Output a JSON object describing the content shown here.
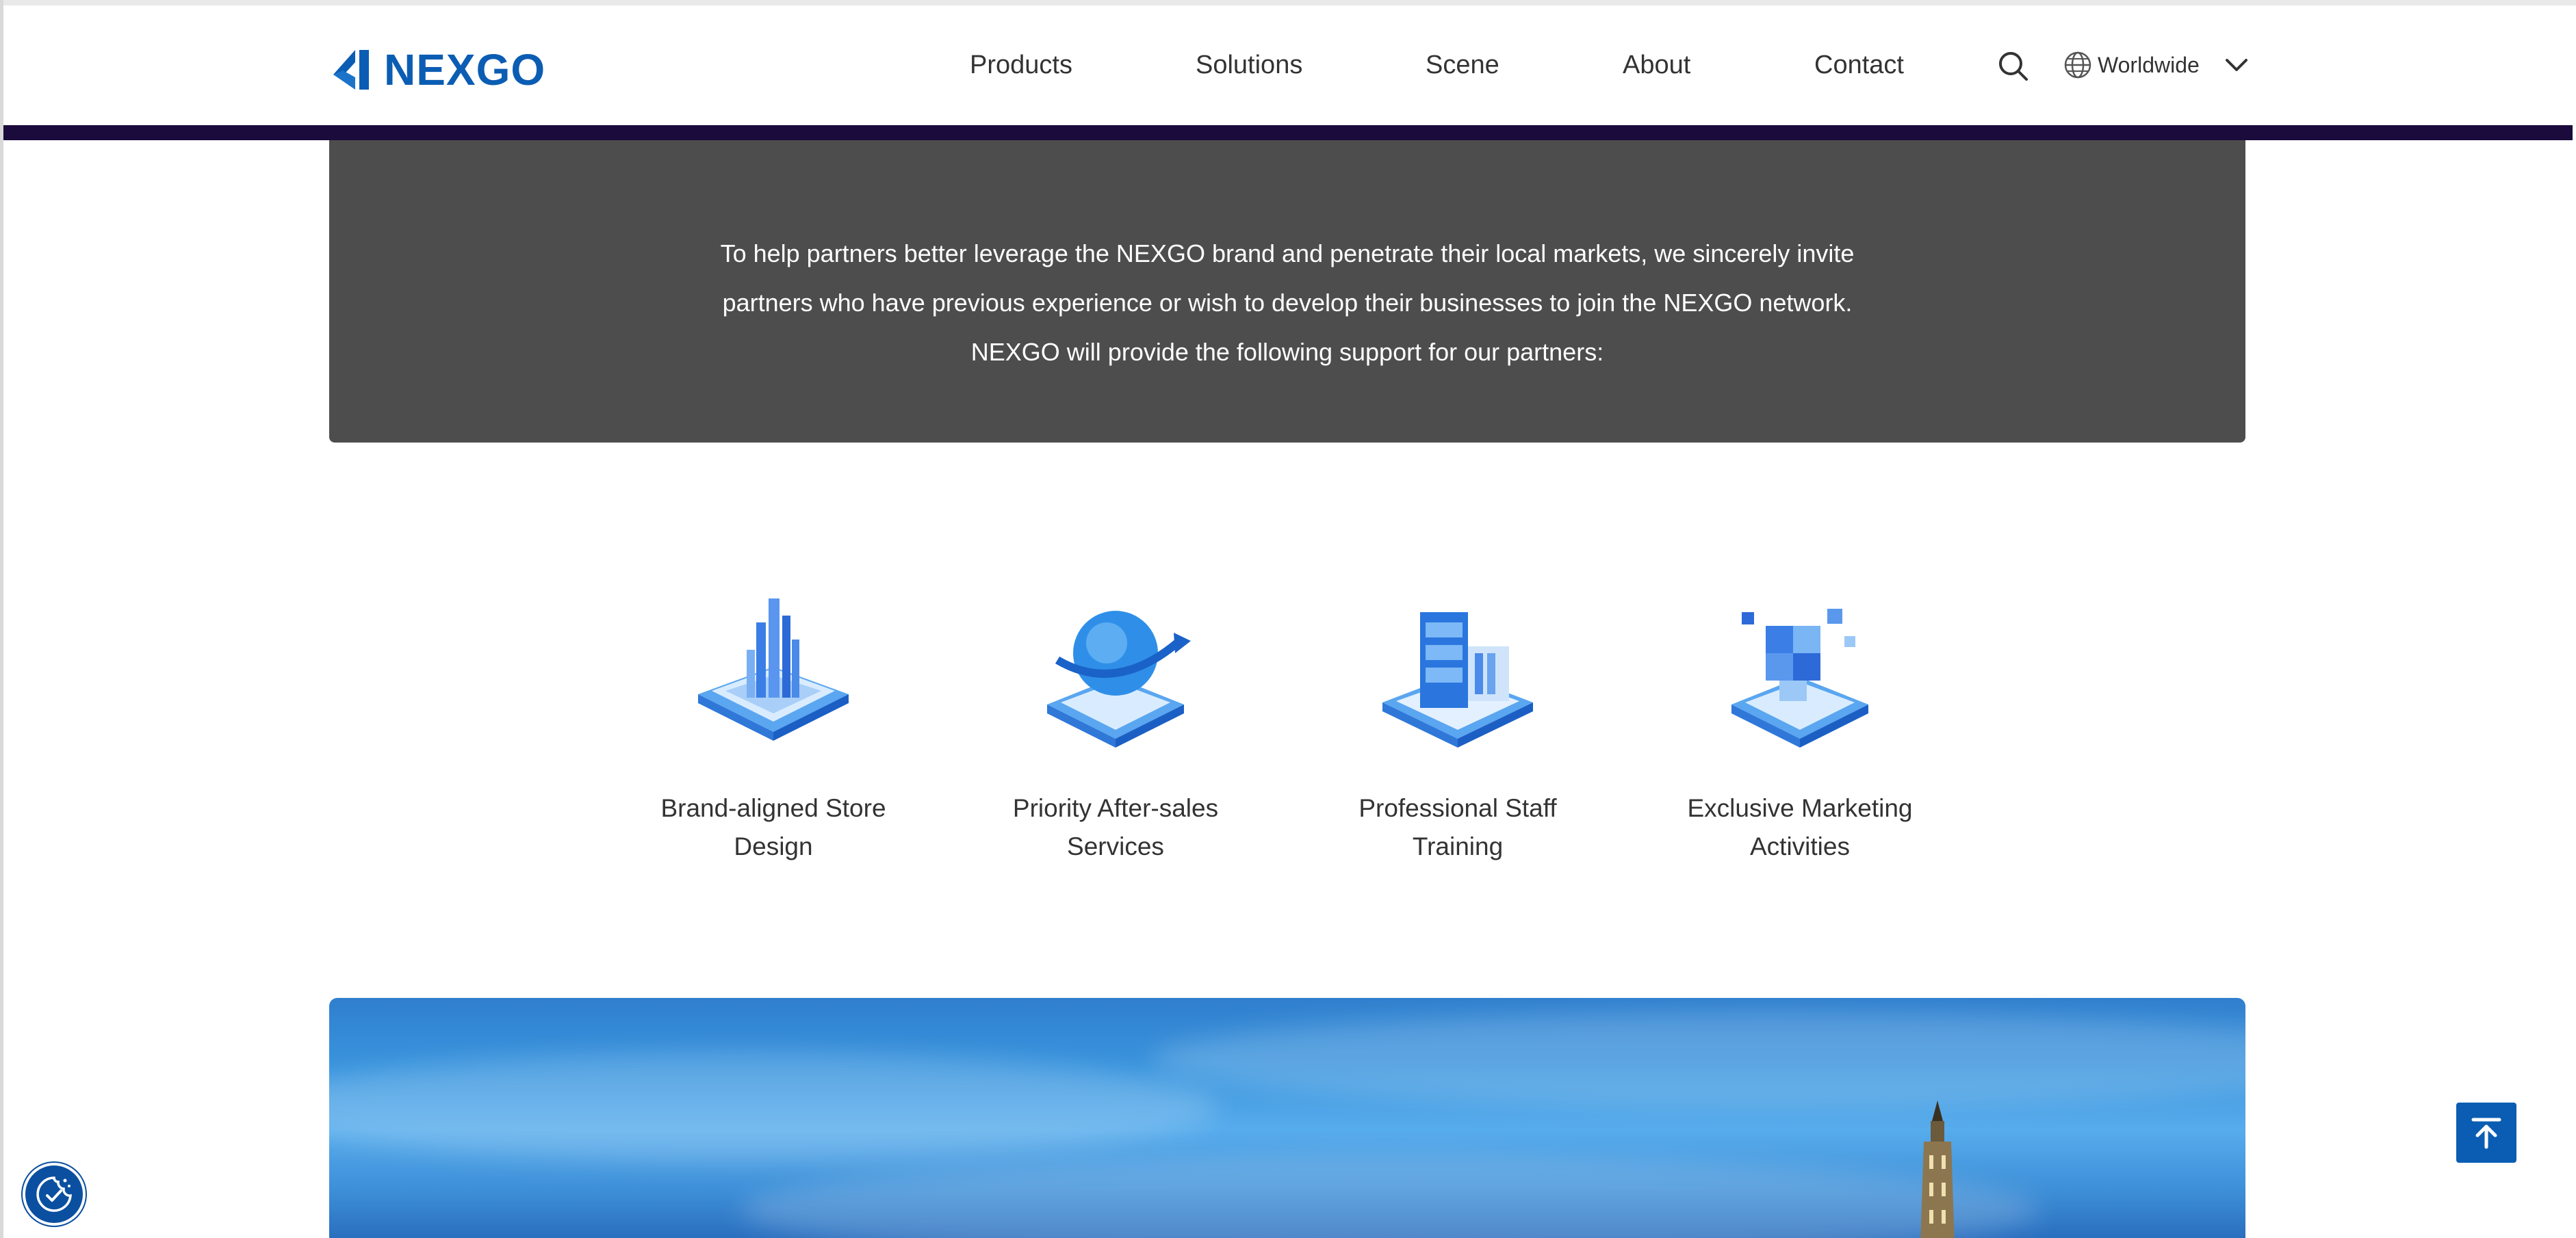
{
  "brand": {
    "logo_text": "NEXGO",
    "logo_color": "#0b5db3"
  },
  "nav": {
    "items": [
      {
        "label": "Products"
      },
      {
        "label": "Solutions"
      },
      {
        "label": "Scene"
      },
      {
        "label": "About"
      },
      {
        "label": "Contact"
      }
    ],
    "search_icon": "search-icon",
    "language": {
      "label": "Worldwide",
      "icon": "globe-icon",
      "dropdown_icon": "chevron-down-icon"
    }
  },
  "intro": {
    "lines": [
      "To help partners better leverage the NEXGO brand and penetrate their local markets, we sincerely invite",
      "partners who have previous experience or wish to develop their businesses to join the NEXGO network.",
      "NEXGO will provide the following support for our partners:"
    ]
  },
  "features": [
    {
      "label_line1": "Brand-aligned Store",
      "label_line2": "Design",
      "icon": "store-design-icon"
    },
    {
      "label_line1": "Priority After-sales",
      "label_line2": "Services",
      "icon": "globe-service-icon"
    },
    {
      "label_line1": "Professional Staff",
      "label_line2": "Training",
      "icon": "training-icon"
    },
    {
      "label_line1": "Exclusive Marketing",
      "label_line2": "Activities",
      "icon": "marketing-cubes-icon"
    }
  ],
  "floating": {
    "back_to_top_icon": "arrow-up-to-top-icon",
    "cookie_icon": "cookie-consent-icon"
  },
  "colors": {
    "header_band": "#1b0a3c",
    "intro_bg": "#4d4d4d",
    "accent": "#0b5db3"
  }
}
